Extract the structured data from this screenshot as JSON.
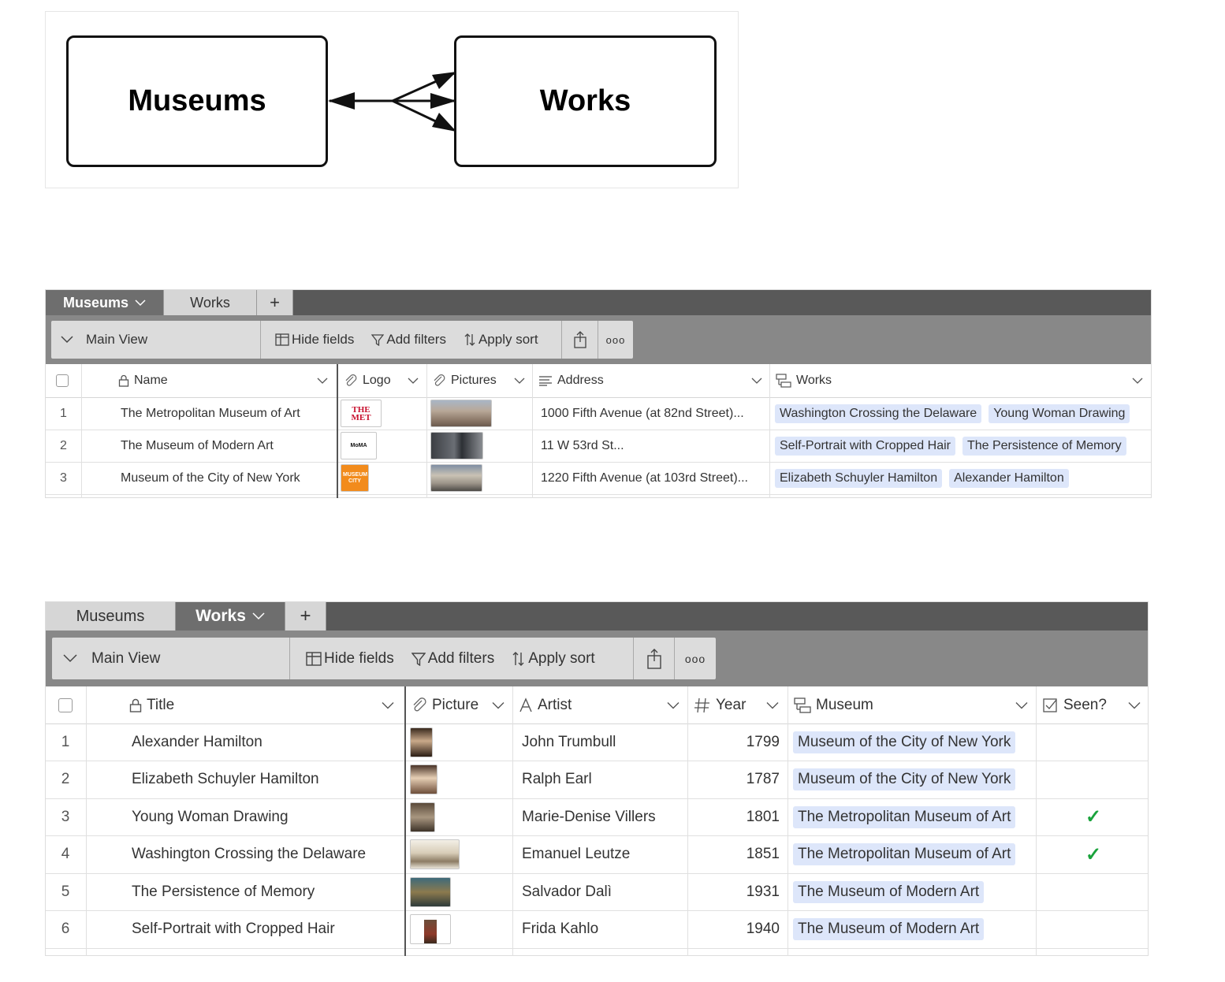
{
  "diagram": {
    "left_entity": "Museums",
    "right_entity": "Works"
  },
  "museums_panel": {
    "tabs": [
      {
        "label": "Museums",
        "active": true
      },
      {
        "label": "Works",
        "active": false
      },
      {
        "label": "+",
        "active": false
      }
    ],
    "toolbar": {
      "view_name": "Main View",
      "hide_fields": "Hide fields",
      "add_filters": "Add filters",
      "apply_sort": "Apply sort",
      "more": "ooo"
    },
    "columns": [
      "Name",
      "Logo",
      "Pictures",
      "Address",
      "Works"
    ],
    "rows": [
      {
        "num": "1",
        "name": "The Metropolitan Museum of Art",
        "logo": "THE MET",
        "address": "1000 Fifth Avenue (at 82nd Street)...",
        "works": [
          "Washington Crossing the Delaware",
          "Young Woman Drawing"
        ]
      },
      {
        "num": "2",
        "name": "The Museum of Modern Art",
        "logo": "MoMA",
        "address": "11 W 53rd St...",
        "works": [
          "Self-Portrait with Cropped Hair",
          "The Persistence of Memory"
        ]
      },
      {
        "num": "3",
        "name": "Museum of the City of New York",
        "logo": "MUSEUM CITY",
        "address": "1220 Fifth Avenue (at 103rd Street)...",
        "works": [
          "Elizabeth Schuyler Hamilton",
          "Alexander Hamilton"
        ]
      }
    ],
    "colors": {
      "logo_met": "#c8102e",
      "logo_mcny": "#f28b1c"
    }
  },
  "works_panel": {
    "tabs": [
      {
        "label": "Museums",
        "active": false
      },
      {
        "label": "Works",
        "active": true
      },
      {
        "label": "+",
        "active": false
      }
    ],
    "toolbar": {
      "view_name": "Main View",
      "hide_fields": "Hide fields",
      "add_filters": "Add filters",
      "apply_sort": "Apply sort",
      "more": "ooo"
    },
    "columns": [
      "Title",
      "Picture",
      "Artist",
      "Year",
      "Museum",
      "Seen?"
    ],
    "rows": [
      {
        "num": "1",
        "title": "Alexander Hamilton",
        "artist": "John Trumbull",
        "year": "1799",
        "museum": "Museum of the City of New York",
        "seen": ""
      },
      {
        "num": "2",
        "title": "Elizabeth Schuyler Hamilton",
        "artist": "Ralph Earl",
        "year": "1787",
        "museum": "Museum of the City of New York",
        "seen": ""
      },
      {
        "num": "3",
        "title": "Young Woman Drawing",
        "artist": "Marie-Denise Villers",
        "year": "1801",
        "museum": "The Metropolitan Museum of Art",
        "seen": "✓"
      },
      {
        "num": "4",
        "title": "Washington Crossing the Delaware",
        "artist": "Emanuel Leutze",
        "year": "1851",
        "museum": "The Metropolitan Museum of Art",
        "seen": "✓"
      },
      {
        "num": "5",
        "title": "The Persistence of Memory",
        "artist": "Salvador Dalì",
        "year": "1931",
        "museum": "The Museum of Modern Art",
        "seen": ""
      },
      {
        "num": "6",
        "title": "Self-Portrait with Cropped Hair",
        "artist": "Frida Kahlo",
        "year": "1940",
        "museum": "The Museum of Modern Art",
        "seen": ""
      }
    ],
    "colors": {
      "check": "#1aa33c",
      "link_pill": "#dde6fa"
    }
  }
}
